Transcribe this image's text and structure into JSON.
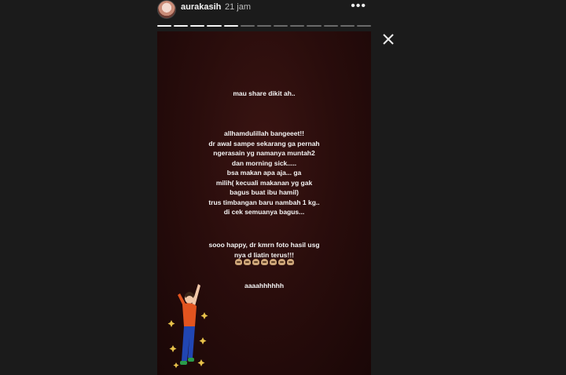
{
  "header": {
    "username": "aurakasih",
    "timestamp": "21 jam",
    "more_label": "•••"
  },
  "progress": {
    "segments": 13,
    "completed": 5
  },
  "story": {
    "line1": "mau share dikit ah..",
    "paragraph": [
      "allhamdulillah bangeeet!!",
      "dr awal sampe sekarang ga pernah",
      "ngerasain yg namanya muntah2",
      "dan morning sick.....",
      "bsa makan apa aja... ga",
      "milih( kecuali makanan yg gak",
      "bagus buat ibu hamil)",
      "trus timbangan baru nambah 1 kg..",
      "di cek semuanya bagus..."
    ],
    "happy": [
      "sooo happy, dr kmrn foto hasil usg",
      "nya d liatin terus!!!"
    ],
    "emoji_count": 7,
    "closing": "aaaahhhhhh"
  },
  "colors": {
    "story_bg": "#2a0d0c",
    "page_bg": "#1b1b1b",
    "figure_shirt": "#e2541f",
    "figure_pants": "#2146b3",
    "sparkle": "#e8c24a"
  },
  "icons": {
    "close": "close-icon",
    "more": "more-options-icon",
    "avatar": "profile-avatar"
  }
}
